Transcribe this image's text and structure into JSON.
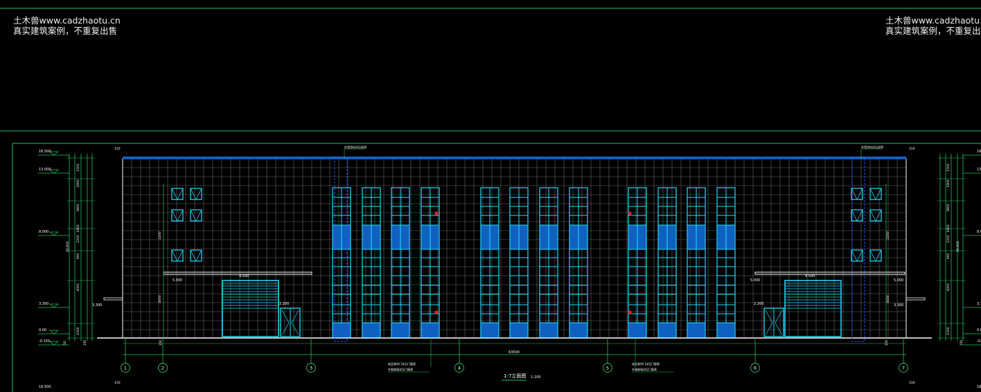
{
  "watermark": {
    "left_line1": "土木兽www.cadzhaotu.cn",
    "left_line2": "真实建筑案例，不重复出售",
    "right_line1": "土木兽www.cadzhaotu.",
    "right_line2": "真实建筑案例，不重复出"
  },
  "drawing": {
    "title": "1-7立面图",
    "scale": "1:100",
    "total_dimension": "63500",
    "axis_labels": [
      "1",
      "2",
      "3",
      "4",
      "5",
      "6",
      "7"
    ],
    "callout_text": "外墙涂料详见说明",
    "note_lines": [
      "成品卷帘门详见门窗表",
      "外窗玻璃详见门窗表"
    ],
    "elev_left": [
      "16.500",
      "13.000",
      "8.000",
      "3.300",
      "0.00",
      "-0.150"
    ],
    "elev_right": [
      "16.500",
      "13.000",
      "8.000",
      "3.300",
      "0.00",
      "-0.150"
    ],
    "left_dims": [
      "1500",
      "1800",
      "3800",
      "1800",
      "2200",
      "900",
      "4000",
      "1000"
    ],
    "left_total": "16.650",
    "canopy_left": "4.500",
    "canopy_right": "4.500",
    "canopy_level_left": "5.000",
    "canopy_level_right": "5.000",
    "door_level_left": "2.200",
    "door_level_right": "2.200",
    "parapet_dim": "150",
    "side_dims_small": [
      "150",
      "600",
      "150"
    ],
    "colors": {
      "frame": "#22c55e",
      "window": "#22e0ff",
      "panel": "#1060c0",
      "grid": "#6a6a6a",
      "text": "#ffffff",
      "accent": "#ff2020"
    }
  }
}
